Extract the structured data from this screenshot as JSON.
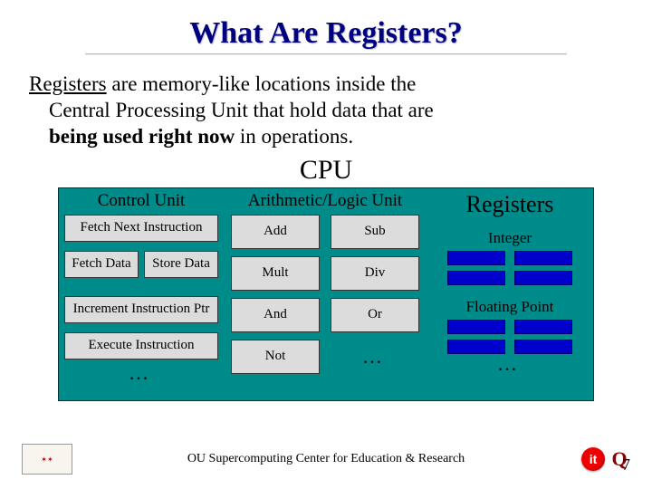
{
  "title": "What Are Registers?",
  "definition": {
    "line1_prefix": "Registers",
    "line1_rest": " are memory-like locations inside the",
    "line2": "Central Processing Unit that hold data that are ",
    "line3_bold": "being used right now",
    "line3_rest": " in operations."
  },
  "cpu": {
    "header": "CPU",
    "control_unit": {
      "title": "Control Unit",
      "fetch_instruction": "Fetch Next Instruction",
      "fetch_data": "Fetch Data",
      "store_data": "Store Data",
      "increment_ptr": "Increment Instruction Ptr",
      "execute": "Execute Instruction",
      "ellipsis": "…"
    },
    "alu": {
      "title": "Arithmetic/Logic Unit",
      "ops": [
        "Add",
        "Sub",
        "Mult",
        "Div",
        "And",
        "Or",
        "Not"
      ],
      "ellipsis": "…"
    },
    "registers": {
      "title": "Registers",
      "integer": "Integer",
      "floating_point": "Floating Point",
      "ellipsis": "…"
    }
  },
  "footer": {
    "center": "OU Supercomputing Center for Education & Research",
    "page": "7"
  }
}
